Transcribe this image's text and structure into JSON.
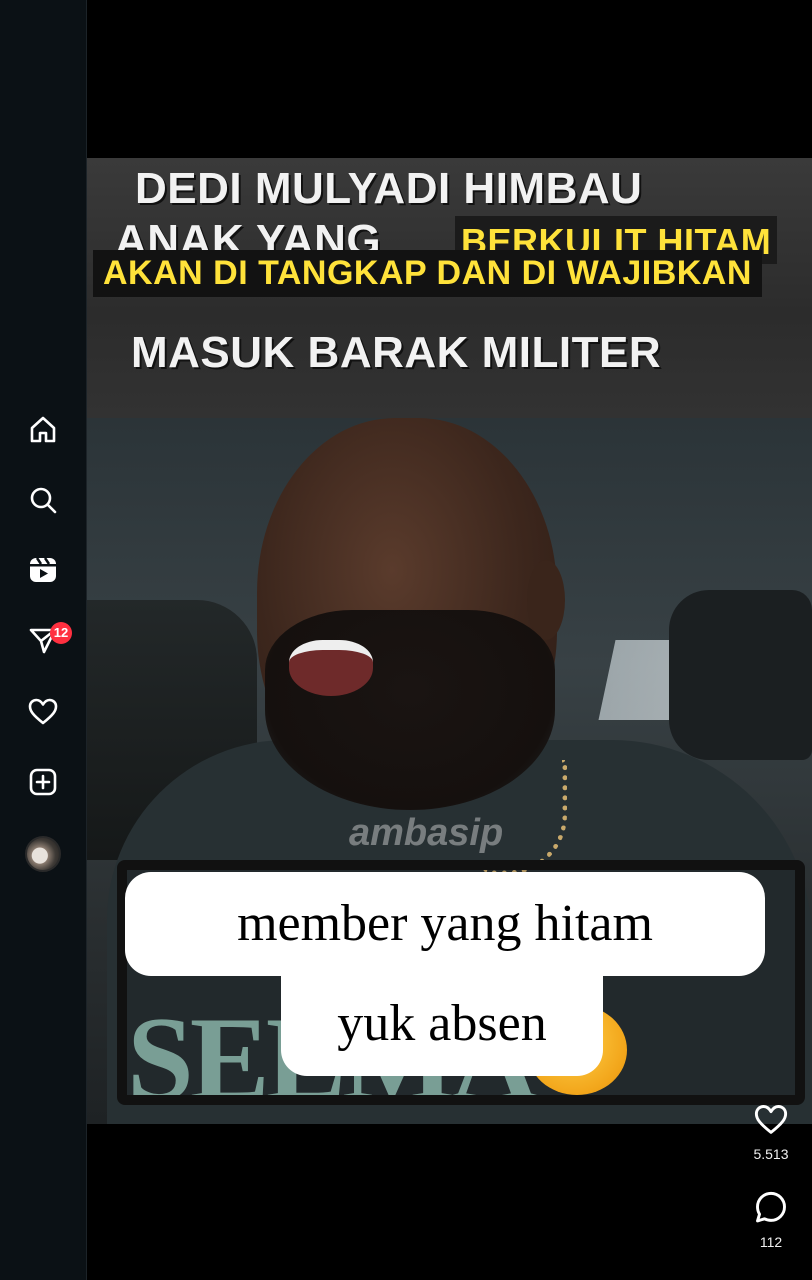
{
  "sidebar": {
    "items": [
      {
        "name": "home",
        "icon": "home-icon"
      },
      {
        "name": "search",
        "icon": "search-icon"
      },
      {
        "name": "reels",
        "icon": "reels-icon"
      },
      {
        "name": "messages",
        "icon": "direct-message-icon",
        "badge": "12"
      },
      {
        "name": "notifications",
        "icon": "heart-icon"
      },
      {
        "name": "create",
        "icon": "plus-square-icon"
      },
      {
        "name": "profile",
        "icon": "avatar"
      }
    ]
  },
  "video": {
    "headline": {
      "line1": "DEDI MULYADI HIMBAU",
      "line2_white": "ANAK YANG",
      "line2_yellow": "BERKULIT HITAM",
      "line3": "AKAN DI TANGKAP DAN DI WAJIBKAN",
      "line4": "MASUK BARAK MILITER"
    },
    "watermark": "ambasip",
    "caption_line1": "member yang hitam",
    "caption_line2": "yuk absen",
    "shirt_print": "SELMA"
  },
  "actions": {
    "likes": "5.513",
    "comments": "112"
  },
  "colors": {
    "sidebar_bg": "#0b1115",
    "badge": "#ff3040",
    "headline_yellow": "#ffe23a"
  }
}
